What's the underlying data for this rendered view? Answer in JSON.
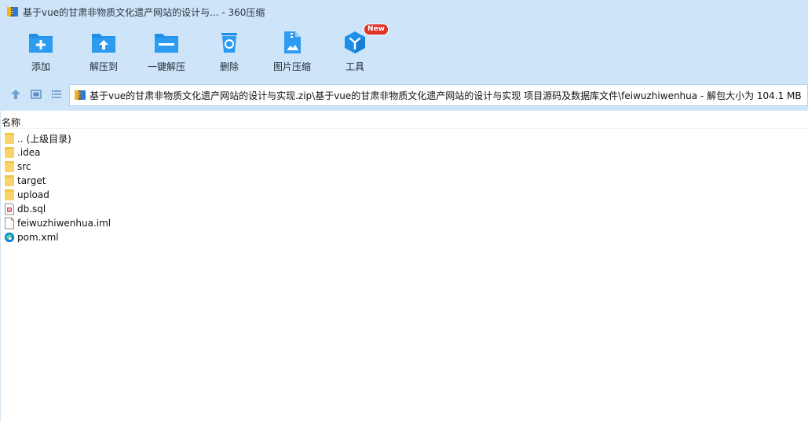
{
  "window": {
    "title": "基于vue的甘肃非物质文化遗产网站的设计与...  - 360压缩"
  },
  "toolbar": {
    "buttons": [
      {
        "label": "添加",
        "icon": "add-folder-icon"
      },
      {
        "label": "解压到",
        "icon": "extract-to-icon"
      },
      {
        "label": "一键解压",
        "icon": "one-click-extract-icon"
      },
      {
        "label": "删除",
        "icon": "recycle-bin-icon"
      },
      {
        "label": "图片压缩",
        "icon": "image-compress-icon"
      },
      {
        "label": "工具",
        "icon": "tools-cube-icon",
        "badge": "New"
      }
    ]
  },
  "address": {
    "path": "基于vue的甘肃非物质文化遗产网站的设计与实现.zip\\基于vue的甘肃非物质文化遗产网站的设计与实现 项目源码及数据库文件\\feiwuzhiwenhua - 解包大小为 104.1 MB"
  },
  "list": {
    "column_name": "名称",
    "files": [
      {
        "name": ".. (上级目录)",
        "type": "folder"
      },
      {
        "name": ".idea",
        "type": "folder"
      },
      {
        "name": "src",
        "type": "folder"
      },
      {
        "name": "target",
        "type": "folder"
      },
      {
        "name": "upload",
        "type": "folder"
      },
      {
        "name": "db.sql",
        "type": "sql"
      },
      {
        "name": "feiwuzhiwenhua.iml",
        "type": "file"
      },
      {
        "name": "pom.xml",
        "type": "edge-xml"
      }
    ]
  },
  "colors": {
    "chrome_bg": "#cde4f9",
    "icon_blue": "#1e8ee9",
    "folder_yellow": "#f9d46b",
    "badge_red": "#e0312b"
  }
}
